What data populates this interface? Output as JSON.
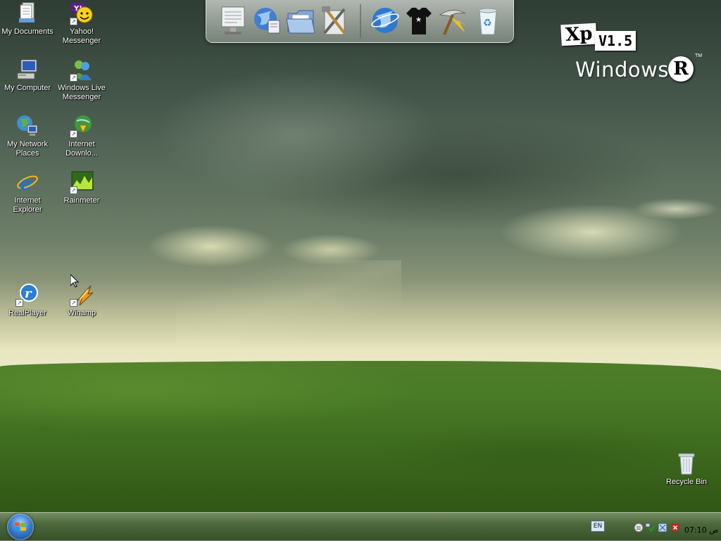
{
  "desktop": {
    "icons": [
      {
        "label": "My Documents"
      },
      {
        "label": "Yahoo!\nMessenger"
      },
      {
        "label": "My Computer"
      },
      {
        "label": "Windows Live\nMessenger"
      },
      {
        "label": "My Network\nPlaces"
      },
      {
        "label": "Internet\nDownlo..."
      },
      {
        "label": "Internet\nExplorer"
      },
      {
        "label": "Rainmeter"
      },
      {
        "label": "RealPlayer"
      },
      {
        "label": "Winamp"
      },
      {
        "label": "Recycle Bin"
      }
    ]
  },
  "dock": {
    "items": [
      {
        "icon": "monitor-icon"
      },
      {
        "icon": "network-globe-icon"
      },
      {
        "icon": "folder-icon"
      },
      {
        "icon": "tools-icon"
      },
      {
        "icon": "internet-globe-icon"
      },
      {
        "icon": "tshirt-icon"
      },
      {
        "icon": "pickaxe-icon"
      },
      {
        "icon": "recycle-bin-icon"
      }
    ]
  },
  "logo": {
    "xp": "Xp",
    "version": "V1.5",
    "windows": "Windows",
    "r": "R",
    "tm": "TM"
  },
  "taskbar": {
    "language": "EN",
    "clock": "07:10 ص"
  },
  "colors": {
    "sky_dark": "#2f3d34",
    "grass": "#3f6c1f",
    "horizon": "#e9e7c0"
  }
}
